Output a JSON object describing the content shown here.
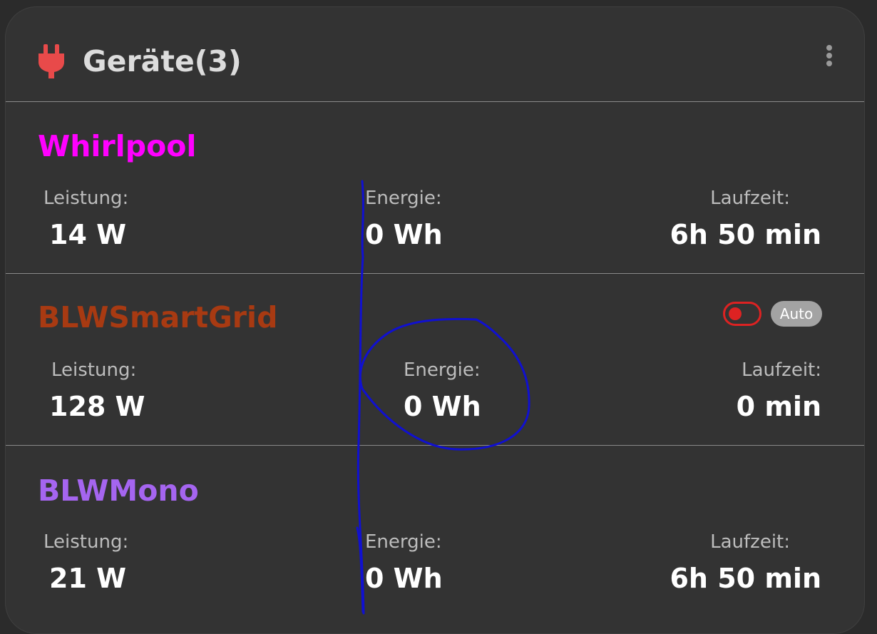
{
  "header": {
    "title": "Geräte(3)",
    "icon": "plug-icon",
    "menu_icon": "more-vertical-icon",
    "icon_color": "#e84a4a"
  },
  "devices": [
    {
      "name": "Whirlpool",
      "color": "#ff00ff",
      "power_label": "Leistung:",
      "power_value": "14 W",
      "energy_label": "Energie:",
      "energy_value": "0 Wh",
      "runtime_label": "Laufzeit:",
      "runtime_value": "6h 50 min"
    },
    {
      "name": "BLWSmartGrid",
      "color": "#a83a12",
      "power_label": "Leistung:",
      "power_value": "128 W",
      "energy_label": "Energie:",
      "energy_value": "0 Wh",
      "runtime_label": "Laufzeit:",
      "runtime_value": "0 min",
      "toggle": {
        "state": "off",
        "color": "#dd2222"
      },
      "auto_label": "Auto"
    },
    {
      "name": "BLWMono",
      "color": "#a565f0",
      "power_label": "Leistung:",
      "power_value": "21 W",
      "energy_label": "Energie:",
      "energy_value": "0 Wh",
      "runtime_label": "Laufzeit:",
      "runtime_value": "6h 50 min"
    }
  ],
  "annotation": {
    "color": "#1010d0"
  }
}
